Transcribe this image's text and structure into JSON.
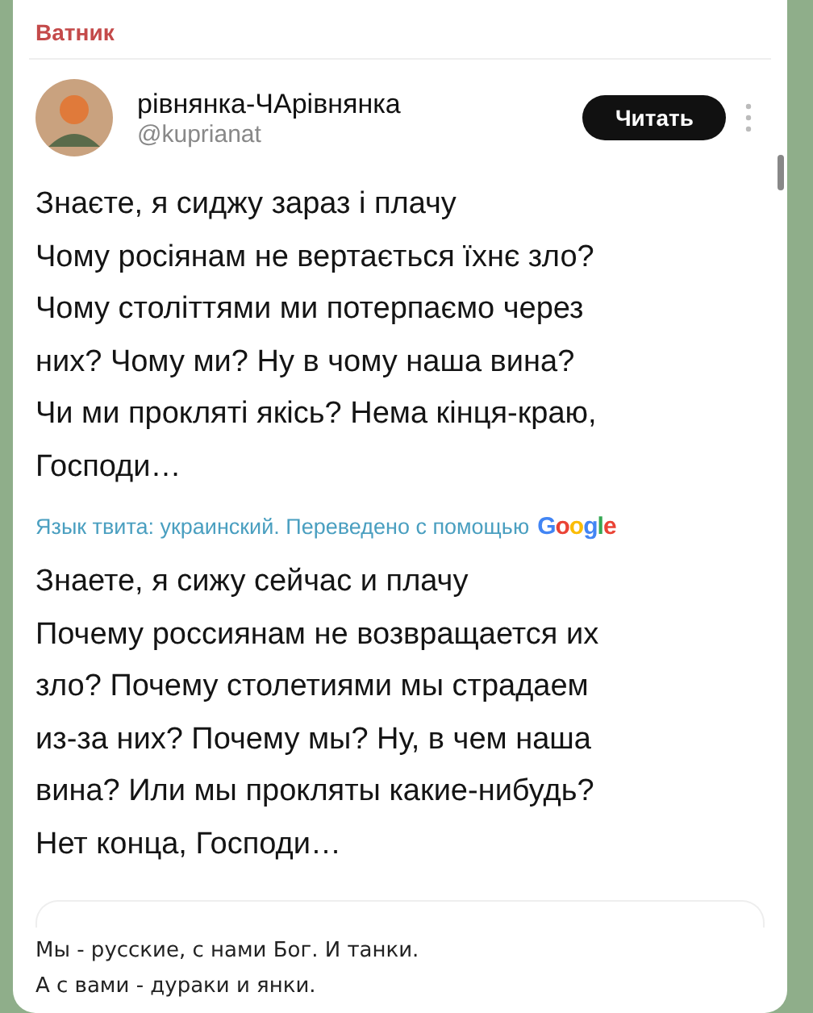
{
  "message": {
    "sender": "Ватник",
    "tweet": {
      "author": "рівнянка-ЧАрівнянка",
      "handle": "@kuprianat",
      "follow_button": "Читать",
      "text_lines": [
        "Знаєте, я сиджу зараз і плачу",
        "Чому росіянам не вертається їхнє зло?",
        "Чому століттями ми потерпаємо через",
        "них? Чому ми? Ну в чому наша вина?",
        "Чи ми прокляті якісь? Нема кінця-краю,",
        "Господи…"
      ],
      "translation_note": "Язык твита: украинский. Переведено с помощью",
      "translator": "Google",
      "translated_lines": [
        "Знаете, я сижу сейчас и плачу",
        "Почему россиянам не возвращается их",
        "зло? Почему столетиями мы страдаем",
        "из-за них? Почему мы? Ну, в чем наша",
        "вина? Или мы прокляты какие-нибудь?",
        "Нет конца, Господи…"
      ]
    },
    "caption_lines": [
      "Мы - русские, с нами Бог. И танки.",
      "А с вами - дураки и янки."
    ]
  }
}
